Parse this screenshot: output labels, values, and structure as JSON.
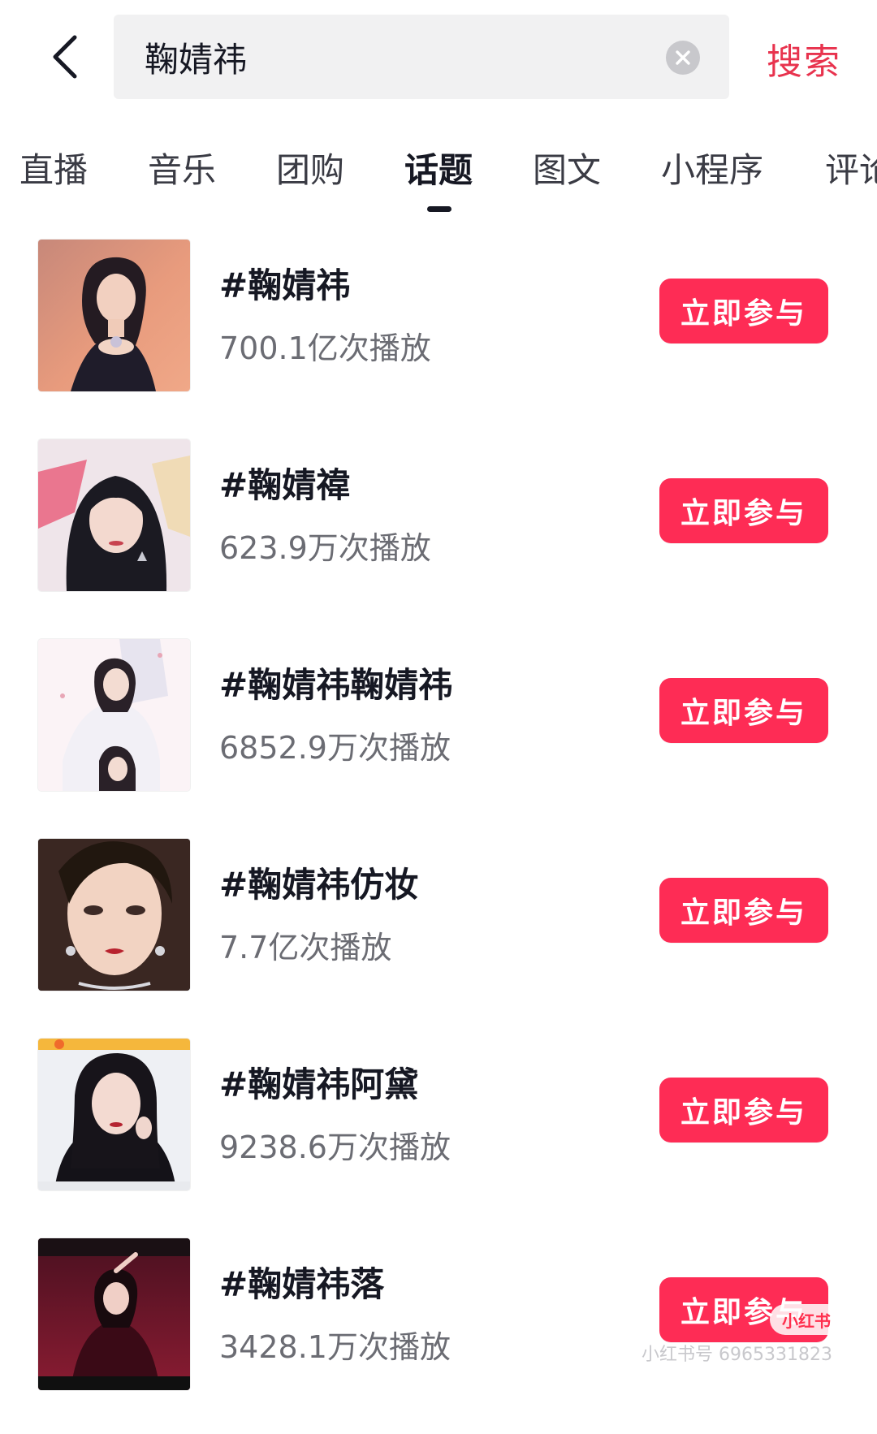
{
  "header": {
    "search_value": "鞠婧祎",
    "search_action_label": "搜索"
  },
  "tabs": [
    {
      "label": "直播",
      "active": false
    },
    {
      "label": "音乐",
      "active": false
    },
    {
      "label": "团购",
      "active": false
    },
    {
      "label": "话题",
      "active": true
    },
    {
      "label": "图文",
      "active": false
    },
    {
      "label": "小程序",
      "active": false
    },
    {
      "label": "评论",
      "active": false
    }
  ],
  "topics": [
    {
      "title": "#鞠婧祎",
      "plays": "700.1亿次播放",
      "button_label": "立即参与",
      "thumb_icon": "portrait-photo"
    },
    {
      "title": "#鞠婧禕",
      "plays": "623.9万次播放",
      "button_label": "立即参与",
      "thumb_icon": "portrait-photo"
    },
    {
      "title": "#鞠婧祎鞠婧祎",
      "plays": "6852.9万次播放",
      "button_label": "立即参与",
      "thumb_icon": "portrait-photo"
    },
    {
      "title": "#鞠婧祎仿妆",
      "plays": "7.7亿次播放",
      "button_label": "立即参与",
      "thumb_icon": "portrait-photo"
    },
    {
      "title": "#鞠婧祎阿黛",
      "plays": "9238.6万次播放",
      "button_label": "立即参与",
      "thumb_icon": "portrait-photo"
    },
    {
      "title": "#鞠婧祎落",
      "plays": "3428.1万次播放",
      "button_label": "立即参与",
      "thumb_icon": "portrait-photo"
    }
  ],
  "watermark": {
    "text": "小红书号 6965331823",
    "logo_text": "小红书"
  },
  "colors": {
    "accent": "#fe2c55",
    "search_action": "#e8334e",
    "search_bg": "#f1f1f2",
    "primary_text": "#161823",
    "secondary_text": "#6b6c73"
  }
}
